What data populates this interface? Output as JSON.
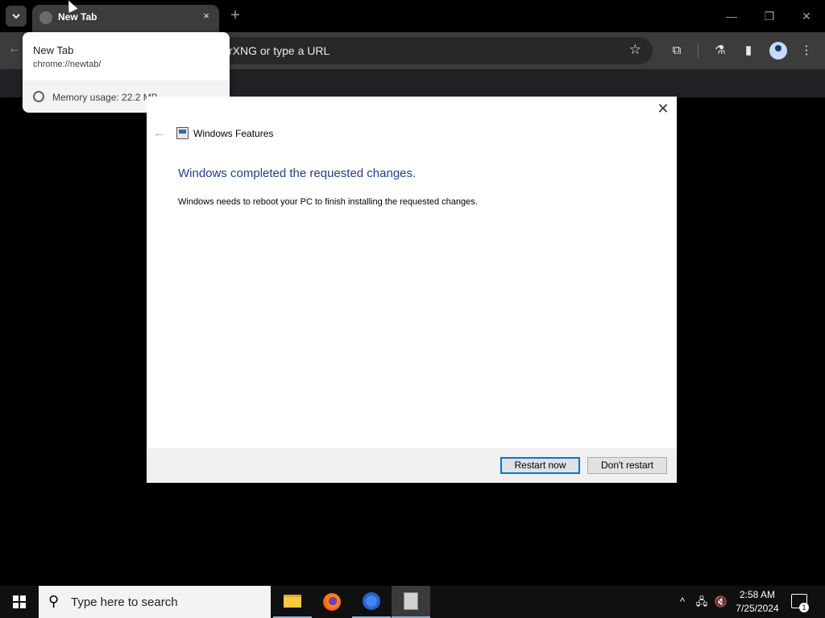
{
  "browser": {
    "tab": {
      "title": "New Tab",
      "close_icon": "×"
    },
    "new_tab_icon": "+",
    "window_controls": {
      "minimize": "—",
      "restore": "❐",
      "close": "✕"
    },
    "omnibox_text": "rXNG or type a URL",
    "hover_card": {
      "title": "New Tab",
      "url": "chrome://newtab/",
      "memory": "Memory usage: 22.2 MB"
    }
  },
  "dialog": {
    "app_title": "Windows Features",
    "heading": "Windows completed the requested changes.",
    "body": "Windows needs to reboot your PC to finish installing the requested changes.",
    "restart_label": "Restart now",
    "dont_restart_label": "Don't restart",
    "close_icon": "✕",
    "back_icon": "←"
  },
  "taskbar": {
    "search_placeholder": "Type here to search",
    "time": "2:58 AM",
    "date": "7/25/2024",
    "notification_count": "1",
    "apps": [
      "file-explorer",
      "firefox",
      "chrome",
      "windows-features"
    ]
  }
}
